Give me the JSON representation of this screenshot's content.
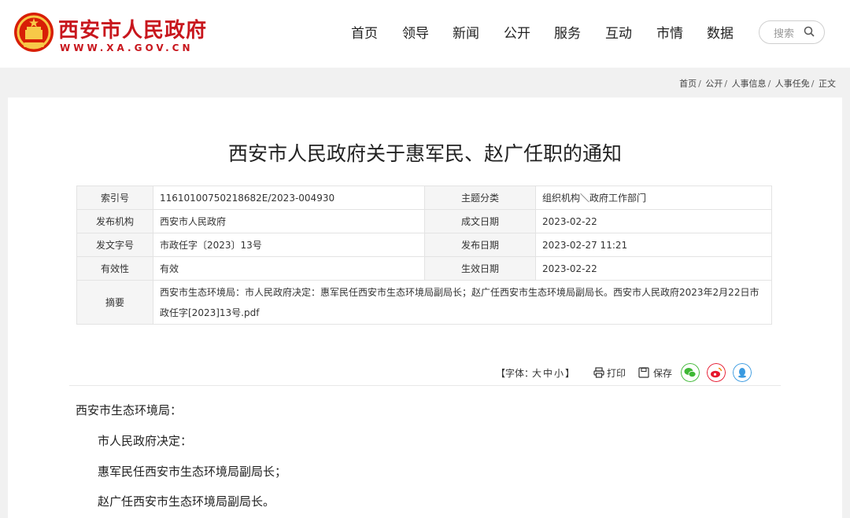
{
  "header": {
    "logo_cn": "西安市人民政府",
    "logo_en": "WWW.XA.GOV.CN",
    "nav": [
      "首页",
      "领导",
      "新闻",
      "公开",
      "服务",
      "互动",
      "市情",
      "数据"
    ],
    "search_placeholder": "搜索"
  },
  "breadcrumb": [
    "首页",
    "公开",
    "人事信息",
    "人事任免",
    "正文"
  ],
  "article": {
    "title": "西安市人民政府关于惠军民、赵广任职的通知",
    "meta": {
      "index_label": "索引号",
      "index_value": "11610100750218682E/2023-004930",
      "topic_label": "主题分类",
      "topic_value": "组织机构＼政府工作部门",
      "issuer_label": "发布机构",
      "issuer_value": "西安市人民政府",
      "created_label": "成文日期",
      "created_value": "2023-02-22",
      "docno_label": "发文字号",
      "docno_value": "市政任字〔2023〕13号",
      "published_label": "发布日期",
      "published_value": "2023-02-27 11:21",
      "validity_label": "有效性",
      "validity_value": "有效",
      "effective_label": "生效日期",
      "effective_value": "2023-02-22",
      "abstract_label": "摘要",
      "abstract_value": "西安市生态环境局：市人民政府决定：惠军民任西安市生态环境局副局长；赵广任西安市生态环境局副局长。西安市人民政府2023年2月22日市政任字[2023]13号.pdf"
    },
    "tools": {
      "font_prefix": "【字体：",
      "font_large": "大",
      "font_medium": "中",
      "font_small": "小",
      "font_suffix": "】",
      "print_label": "打印",
      "save_label": "保存"
    },
    "body": {
      "salutation": "西安市生态环境局：",
      "p1": "市人民政府决定：",
      "p2": "惠军民任西安市生态环境局副局长；",
      "p3": "赵广任西安市生态环境局副局长。"
    }
  },
  "colors": {
    "brand_red": "#c8161d",
    "wechat": "#3fb836",
    "weibo": "#e6162d",
    "qq": "#3a9ae0"
  },
  "icons": [
    "national-emblem-icon",
    "search-icon",
    "print-icon",
    "save-icon",
    "wechat-share-icon",
    "weibo-share-icon",
    "qq-share-icon"
  ]
}
